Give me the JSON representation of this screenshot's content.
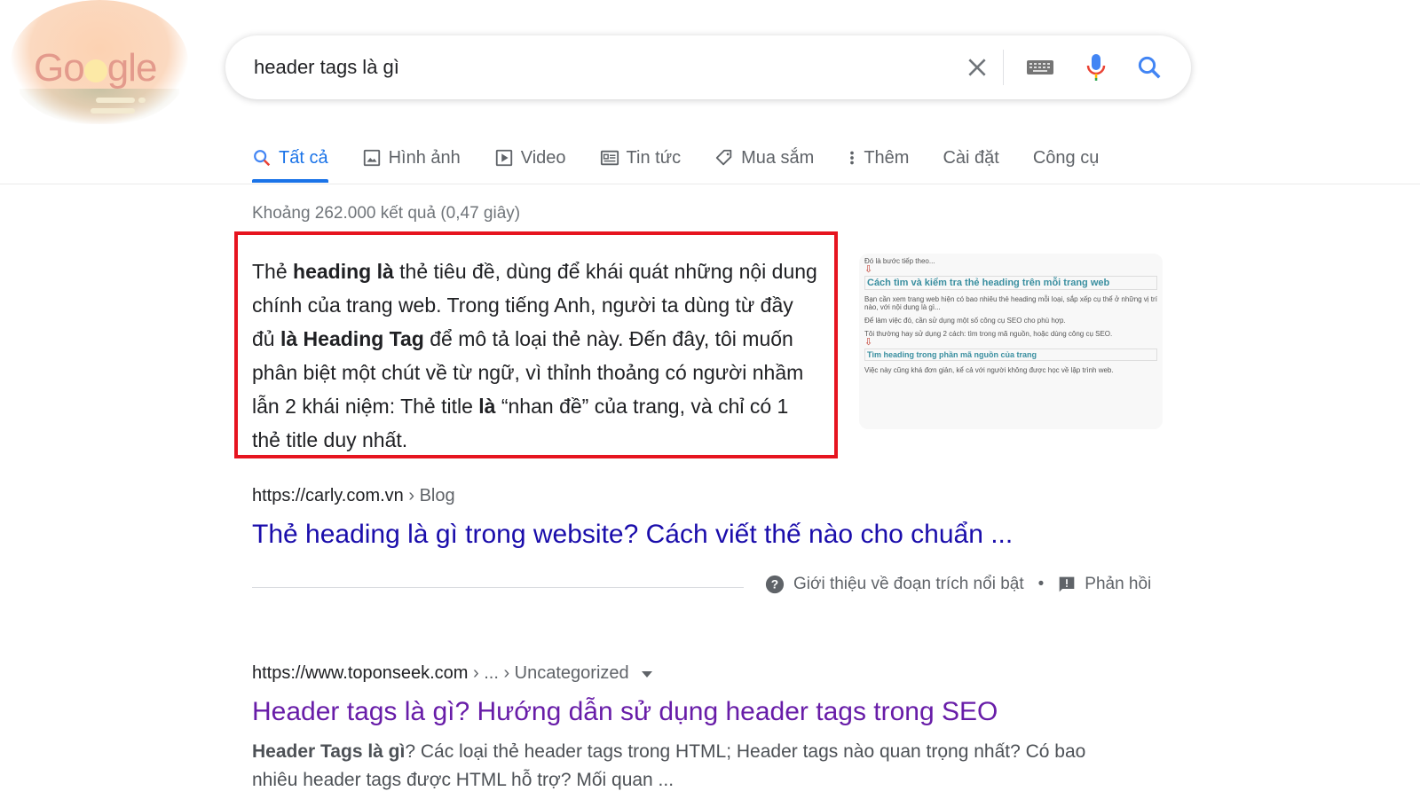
{
  "logo": {
    "text": "Google"
  },
  "search": {
    "query": "header tags là gì"
  },
  "tabs": [
    {
      "label": "Tất cả",
      "icon": "search-icon",
      "active": true
    },
    {
      "label": "Hình ảnh",
      "icon": "image-icon"
    },
    {
      "label": "Video",
      "icon": "play-icon"
    },
    {
      "label": "Tin tức",
      "icon": "news-icon"
    },
    {
      "label": "Mua sắm",
      "icon": "tag-icon"
    },
    {
      "label": "Thêm",
      "icon": "more-vert-icon"
    },
    {
      "label": "Cài đặt"
    },
    {
      "label": "Công cụ"
    }
  ],
  "stats": "Khoảng 262.000 kết quả (0,47 giây)",
  "snippet": {
    "parts": [
      {
        "t": "Thẻ "
      },
      {
        "t": "heading là",
        "b": true
      },
      {
        "t": " thẻ tiêu đề, dùng để khái quát những nội dung chính của trang web. Trong tiếng Anh, người ta dùng từ đầy đủ "
      },
      {
        "t": "là Heading Tag",
        "b": true
      },
      {
        "t": " để mô tả loại thẻ này. Đến đây, tôi muốn phân biệt một chút về từ ngữ, vì thỉnh thoảng có người nhầm lẫn 2 khái niệm: Thẻ title "
      },
      {
        "t": "là",
        "b": true
      },
      {
        "t": " “nhan đề” của trang, và chỉ có 1 thẻ title duy nhất."
      }
    ],
    "thumb": {
      "l1": "Đó là bước tiếp theo...",
      "h1": "Cách tìm và kiểm tra thẻ heading trên mỗi trang web",
      "l2": "Bạn cần xem trang web hiện có bao nhiêu thẻ heading mỗi loại, sắp xếp cụ thể ở những vị trí nào, với nội dung là gì...",
      "l3": "Để làm việc đó, cần sử dụng một số công cụ SEO cho phù hợp.",
      "l4": "Tôi thường hay sử dụng 2 cách: tìm trong mã nguồn, hoặc dùng công cụ SEO.",
      "h2": "Tìm heading trong phần mã nguồn của trang",
      "l5": "Việc này cũng khá đơn giản, kể cả với người không được học về lập trình web."
    },
    "url": "https://carly.com.vn",
    "crumb": " › Blog",
    "title": "Thẻ heading là gì trong website? Cách viết thế nào cho chuẩn ...",
    "about": "Giới thiệu về đoạn trích nổi bật",
    "sep": "•",
    "feedback": "Phản hồi"
  },
  "result2": {
    "url": "https://www.toponseek.com",
    "crumb": " › ... › Uncategorized",
    "title": "Header tags là gì? Hướng dẫn sử dụng header tags trong SEO",
    "desc_bold": "Header Tags là gì",
    "desc": "? Các loại thẻ header tags trong HTML; Header tags nào quan trọng nhất? Có bao nhiêu header tags được HTML hỗ trợ? Mối quan ..."
  },
  "colors": {
    "accent": "#1a73e8",
    "link": "#1a0dab",
    "visited": "#681da8",
    "highlight_border": "#e6141f"
  }
}
